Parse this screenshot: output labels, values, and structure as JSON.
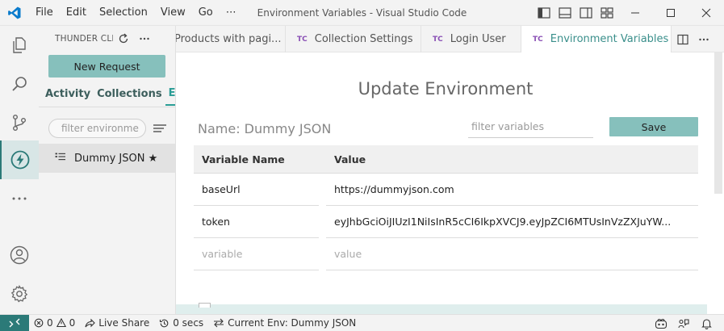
{
  "window": {
    "title": "Environment Variables - Visual Studio Code",
    "menu": [
      "File",
      "Edit",
      "Selection",
      "View",
      "Go",
      "⋯"
    ]
  },
  "sidebar": {
    "title": "THUNDER CLIE...",
    "new_request_label": "New Request",
    "tabs": [
      "Activity",
      "Collections",
      "Env"
    ],
    "filter_placeholder": "filter environme",
    "env_items": [
      {
        "label": "Dummy JSON ★"
      }
    ]
  },
  "tabs": [
    {
      "prefix": "",
      "label": "Products with pagi...",
      "active": false
    },
    {
      "prefix": "TC",
      "label": "Collection Settings",
      "active": false
    },
    {
      "prefix": "TC",
      "label": "Login User",
      "active": false
    },
    {
      "prefix": "TC",
      "label": "Environment Variables",
      "active": true
    }
  ],
  "editor": {
    "heading": "Update Environment",
    "name_value": "Name: Dummy JSON",
    "filter_placeholder": "filter variables",
    "save_label": "Save",
    "table": {
      "headers": [
        "Variable Name",
        "Value"
      ],
      "rows": [
        {
          "name": "baseUrl",
          "value": "https://dummyjson.com"
        },
        {
          "name": "token",
          "value": "eyJhbGciOiJIUzI1NiIsInR5cCI6IkpXVCJ9.eyJpZCI6MTUsInVzZXJuYW..."
        }
      ],
      "placeholder_row": {
        "name": "variable",
        "value": "value"
      }
    }
  },
  "status": {
    "errors": "0",
    "warnings": "0",
    "live_share": "Live Share",
    "timer": "0 secs",
    "current_env": "Current Env: Dummy JSON"
  },
  "colors": {
    "accent": "#2b7a78",
    "button": "#86c0bc",
    "tab_prefix": "#8a4fb5",
    "vscode_blue": "#0a7bcc"
  }
}
